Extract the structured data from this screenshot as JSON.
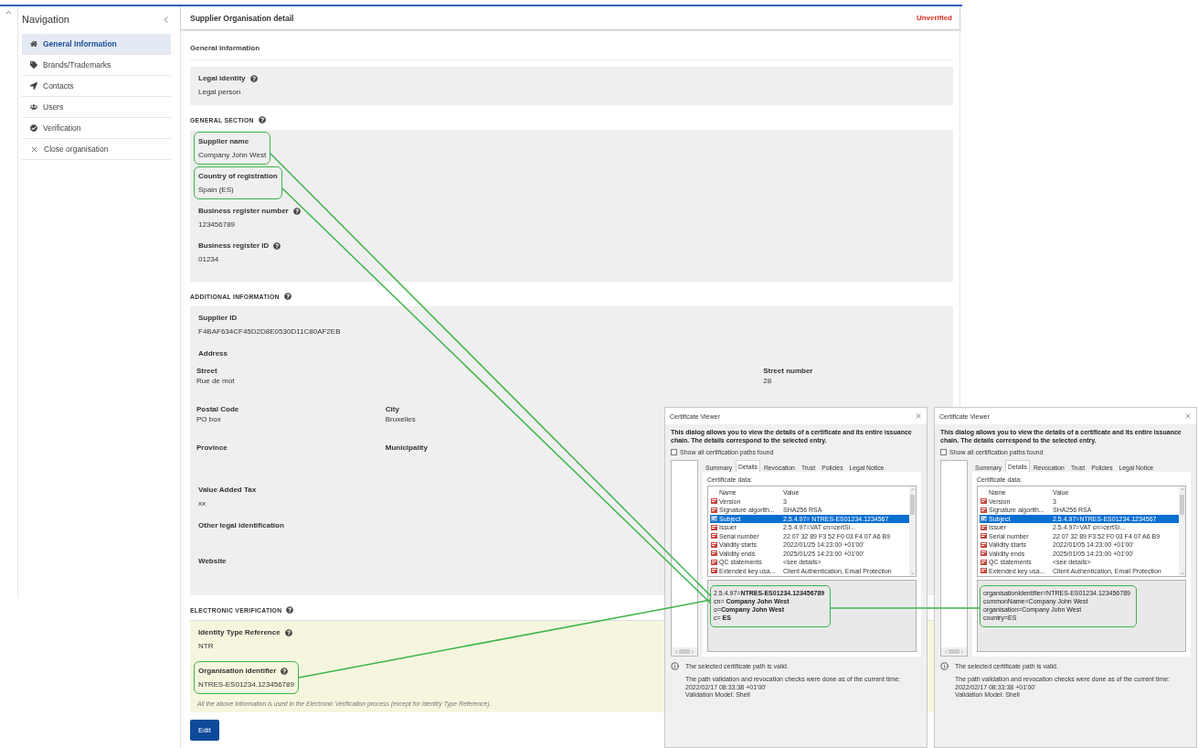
{
  "sidebar": {
    "title": "Navigation",
    "items": [
      {
        "label": "General Information",
        "selected": true
      },
      {
        "label": "Brands/Trademarks",
        "selected": false
      },
      {
        "label": "Contacts",
        "selected": false
      },
      {
        "label": "Users",
        "selected": false
      },
      {
        "label": "Verification",
        "selected": false
      },
      {
        "label": "Close organisation",
        "selected": false
      }
    ]
  },
  "header": {
    "title": "Supplier Organisation detail",
    "status": "Unverified"
  },
  "panel_title": "General Information",
  "legal_identity": {
    "label": "Legal identity",
    "value": "Legal person",
    "help": true
  },
  "general_section": {
    "title": "GENERAL SECTION",
    "help": true,
    "fields": [
      {
        "label": "Supplier name",
        "value": "Company John West",
        "help": false,
        "highlighted": true
      },
      {
        "label": "Country of registration",
        "value": "Spain (ES)",
        "help": false,
        "highlighted": true
      },
      {
        "label": "Business register number",
        "value": "123456789",
        "help": true,
        "highlighted": false
      },
      {
        "label": "Business register ID",
        "value": "01234",
        "help": true,
        "highlighted": false
      }
    ]
  },
  "additional_information": {
    "title": "ADDITIONAL INFORMATION",
    "help": true,
    "supplier_id": {
      "label": "Supplier ID",
      "value": "F4BAF634CF45D2D8E0530D11C80AF2EB"
    },
    "address": {
      "title": "Address",
      "street": {
        "label": "Street",
        "value": "Rue de mot"
      },
      "street_number": {
        "label": "Street number",
        "value": "28"
      },
      "postal_code": {
        "label": "Postal Code",
        "value": "PO box"
      },
      "city": {
        "label": "City",
        "value": "Bruxelles"
      },
      "province": {
        "label": "Province"
      },
      "municipality": {
        "label": "Municipality"
      }
    },
    "fields": [
      {
        "label": "Value Added Tax",
        "value": "xx"
      },
      {
        "label": "Other legal identification"
      },
      {
        "label": "Website"
      }
    ]
  },
  "electronic_verification": {
    "title": "ELECTRONIC VERIFICATION",
    "help": true,
    "fields": [
      {
        "label": "Identity Type Reference",
        "value": "NTR",
        "help": true,
        "highlighted": false
      },
      {
        "label": "Organisation identifier",
        "value": "NTRES-ES01234.123456789",
        "help": true,
        "highlighted": true
      }
    ],
    "note": "All the above Information is used in the Electronic Verification process (except for Identity Type Reference)."
  },
  "edit_button": "Edit",
  "certificate_viewers": [
    {
      "title": "Certificate Viewer",
      "description": "This dialog allows you to view the details of a certificate and its entire issuance chain. The details correspond to the selected entry.",
      "checkbox": {
        "label": "Show all certification paths found",
        "checked": false
      },
      "tabs": [
        {
          "label": "Summary",
          "selected": false
        },
        {
          "label": "Details",
          "selected": true
        },
        {
          "label": "Revocation",
          "selected": false
        },
        {
          "label": "Trust",
          "selected": false
        },
        {
          "label": "Policies",
          "selected": false
        },
        {
          "label": "Legal Notice",
          "selected": false
        }
      ],
      "data_label": "Certificate data:",
      "columns": [
        "Name",
        "Value"
      ],
      "rows": [
        {
          "name": "Version",
          "value": "3",
          "selected": false
        },
        {
          "name": "Signature algorith...",
          "value": "SHA256 RSA",
          "selected": false
        },
        {
          "name": "Subject",
          "value": "2.5.4.97= NTRES-ES01234.1234567",
          "selected": true
        },
        {
          "name": "Issuer",
          "value": "2.5.4.97=VAT cn=certSi...",
          "selected": false
        },
        {
          "name": "Serial number",
          "value": "22 07 32 89 F3 52 F0 03 F4 07 A6 B9",
          "selected": false
        },
        {
          "name": "Validity starts",
          "value": "2022/01/25 14:23:00 +01'00'",
          "selected": false
        },
        {
          "name": "Validity ends",
          "value": "2025/01/25 14:23:00 +01'00'",
          "selected": false
        },
        {
          "name": "QC statements",
          "value": "<see details>",
          "selected": false
        },
        {
          "name": "Extended key usa...",
          "value": "Client Authentication, Email Protection",
          "selected": false
        }
      ],
      "detail_lines": [
        "2.5.4.97=**NTRES-ES01234.123456789**",
        "cn= **Company John West**",
        "o=**Company John West**",
        "c= **ES**"
      ],
      "detail_highlighted": true,
      "status": "The selected certificate path is valid.",
      "notes": [
        "The path validation and revocation checks were done as of the current time:",
        "2022/02/17 08:33:38 +01'00'",
        "Validation Model: Shell"
      ]
    },
    {
      "title": "Certificate Viewer",
      "description": "This dialog allows you to view the details of a certificate and its entire issuance chain. The details correspond to the selected entry.",
      "checkbox": {
        "label": "Show all certification paths found",
        "checked": false
      },
      "tabs": [
        {
          "label": "Summary",
          "selected": false
        },
        {
          "label": "Details",
          "selected": true
        },
        {
          "label": "Revocation",
          "selected": false
        },
        {
          "label": "Trust",
          "selected": false
        },
        {
          "label": "Policies",
          "selected": false
        },
        {
          "label": "Legal Notice",
          "selected": false
        }
      ],
      "data_label": "Certificate data:",
      "columns": [
        "Name",
        "Value"
      ],
      "rows": [
        {
          "name": "Version",
          "value": "3",
          "selected": false
        },
        {
          "name": "Signature algorith...",
          "value": "SHA256 RSA",
          "selected": false
        },
        {
          "name": "Subject",
          "value": "2.5.4.97=NTRES-ES01234.1234567",
          "selected": true
        },
        {
          "name": "Issuer",
          "value": "2.5.4.97=VAT cn=certSi...",
          "selected": false
        },
        {
          "name": "Serial number",
          "value": "22 07 32 89 F3 52 F0 03 F4 07 A6 B9",
          "selected": false
        },
        {
          "name": "Validity starts",
          "value": "2022/01/05 14:23:00 +01'00'",
          "selected": false
        },
        {
          "name": "Validity ends",
          "value": "2025/01/05 14:23:00 +01'00'",
          "selected": false
        },
        {
          "name": "QC statements",
          "value": "<see details>",
          "selected": false
        },
        {
          "name": "Extended key usa...",
          "value": "Client Authentication, Email Protection",
          "selected": false
        }
      ],
      "detail_lines": [
        "organisationIdentifier=NTRES-ES01234.123456789",
        "commonName=Company John West",
        "organisation=Company John West",
        "country=ES"
      ],
      "detail_highlighted": true,
      "status": "The selected certificate path is valid.",
      "notes": [
        "The path validation and revocation checks were done as of the current time:",
        "2022/02/17 08:33:38 +01'00'",
        "Validation Model: Shell"
      ]
    }
  ]
}
